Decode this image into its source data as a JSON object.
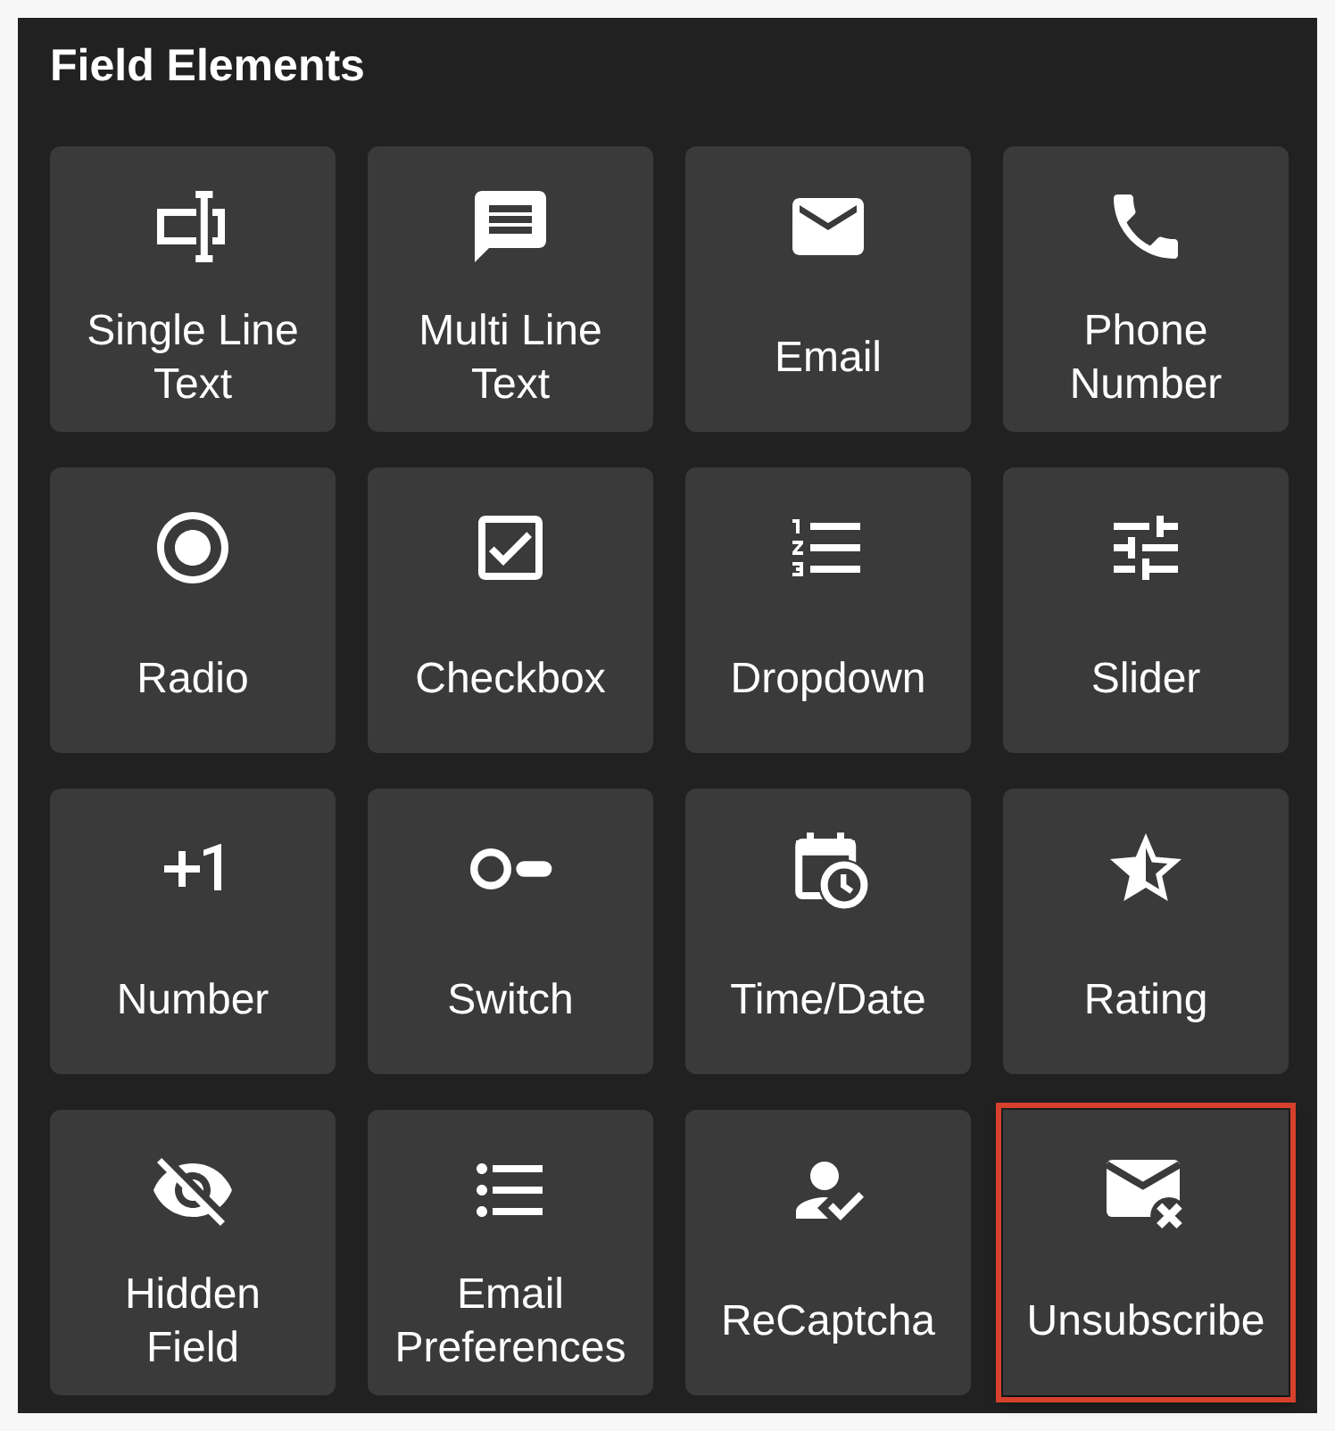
{
  "panel": {
    "title": "Field Elements",
    "elements": [
      {
        "kind": "single_line",
        "label": "Single Line\nText",
        "highlighted": false
      },
      {
        "kind": "multi_line",
        "label": "Multi Line\nText",
        "highlighted": false
      },
      {
        "kind": "email",
        "label": "Email",
        "highlighted": false
      },
      {
        "kind": "phone",
        "label": "Phone\nNumber",
        "highlighted": false
      },
      {
        "kind": "radio",
        "label": "Radio",
        "highlighted": false
      },
      {
        "kind": "checkbox",
        "label": "Checkbox",
        "highlighted": false
      },
      {
        "kind": "dropdown",
        "label": "Dropdown",
        "highlighted": false
      },
      {
        "kind": "slider",
        "label": "Slider",
        "highlighted": false
      },
      {
        "kind": "number",
        "label": "Number",
        "highlighted": false
      },
      {
        "kind": "switch",
        "label": "Switch",
        "highlighted": false
      },
      {
        "kind": "datetime",
        "label": "Time/Date",
        "highlighted": false
      },
      {
        "kind": "rating",
        "label": "Rating",
        "highlighted": false
      },
      {
        "kind": "hidden",
        "label": "Hidden\nField",
        "highlighted": false
      },
      {
        "kind": "email_preferences",
        "label": "Email\nPreferences",
        "highlighted": false
      },
      {
        "kind": "recaptcha",
        "label": "ReCaptcha",
        "highlighted": false
      },
      {
        "kind": "unsubscribe",
        "label": "Unsubscribe",
        "highlighted": true
      }
    ]
  }
}
